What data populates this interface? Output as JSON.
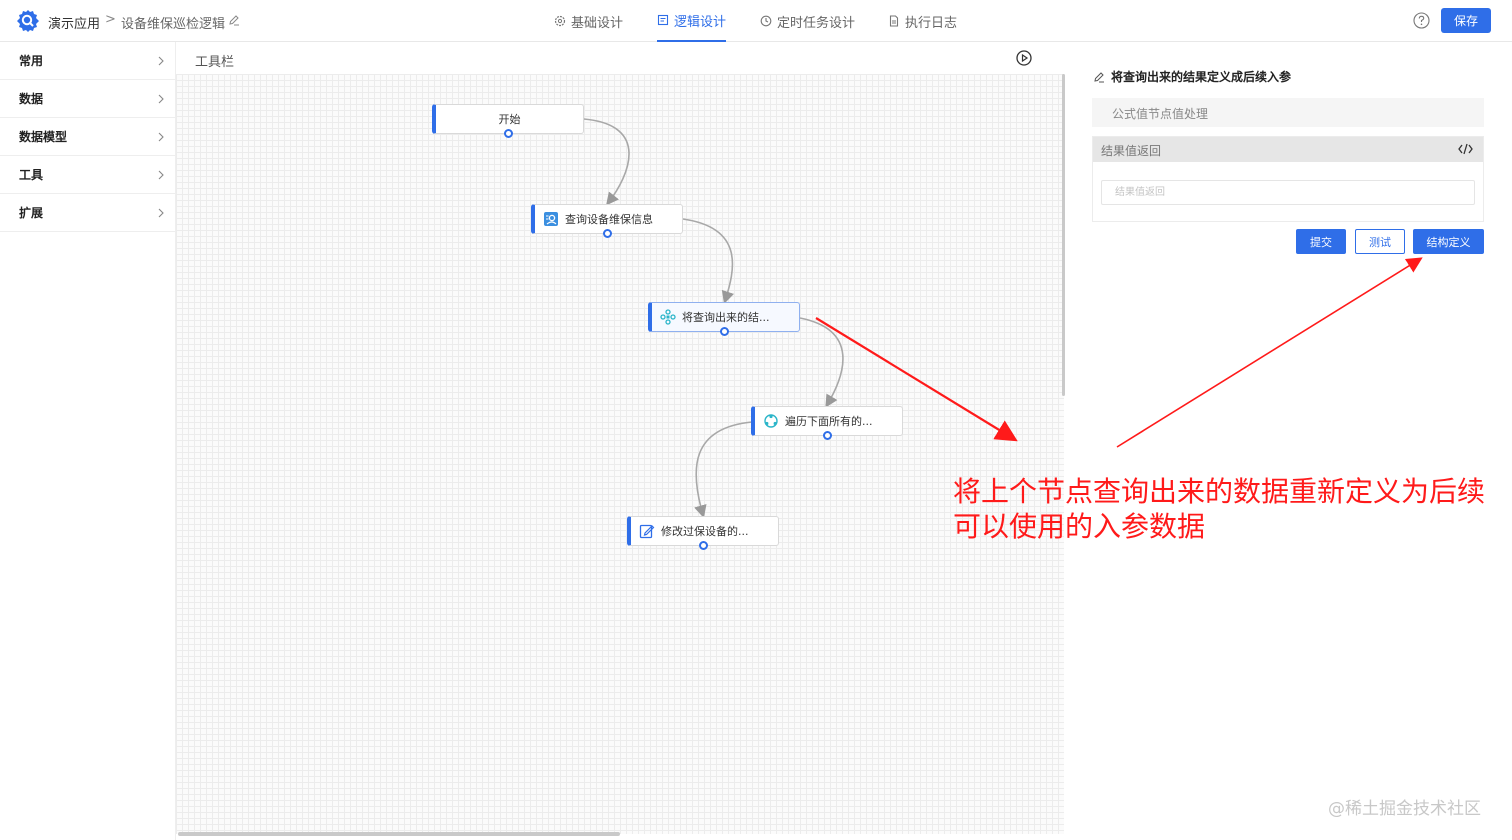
{
  "header": {
    "app_name": "演示应用",
    "breadcrumb_sep": ">",
    "page_name": "设备维保巡检逻辑",
    "tabs": [
      {
        "label": "基础设计",
        "icon": "gear-icon",
        "active": false
      },
      {
        "label": "逻辑设计",
        "icon": "document-icon",
        "active": true
      },
      {
        "label": "定时任务设计",
        "icon": "clock-icon",
        "active": false
      },
      {
        "label": "执行日志",
        "icon": "file-icon",
        "active": false
      }
    ],
    "save_label": "保存",
    "accent_color": "#2f6ee8"
  },
  "sidebar": {
    "items": [
      {
        "label": "常用"
      },
      {
        "label": "数据"
      },
      {
        "label": "数据模型"
      },
      {
        "label": "工具"
      },
      {
        "label": "扩展"
      }
    ]
  },
  "canvas": {
    "toolbar_label": "工具栏",
    "nodes": [
      {
        "label": "开始",
        "icon": "none"
      },
      {
        "label": "查询设备维保信息",
        "icon": "query-icon"
      },
      {
        "label": "将查询出来的结...",
        "icon": "transform-icon"
      },
      {
        "label": "遍历下面所有的...",
        "icon": "loop-icon"
      },
      {
        "label": "修改过保设备的...",
        "icon": "edit-icon"
      }
    ]
  },
  "panel": {
    "title": "将查询出来的结果定义成后续入参",
    "formula_label": "公式值节点值处理",
    "result_label": "结果值返回",
    "result_placeholder": "结果值返回",
    "buttons": {
      "submit": "提交",
      "test": "测试",
      "struct": "结构定义"
    }
  },
  "annotation": {
    "text": "将上个节点查询出来的数据重新定义为后续可以使用的入参数据",
    "color": "#ff1a1a"
  },
  "watermark": "@稀土掘金技术社区"
}
